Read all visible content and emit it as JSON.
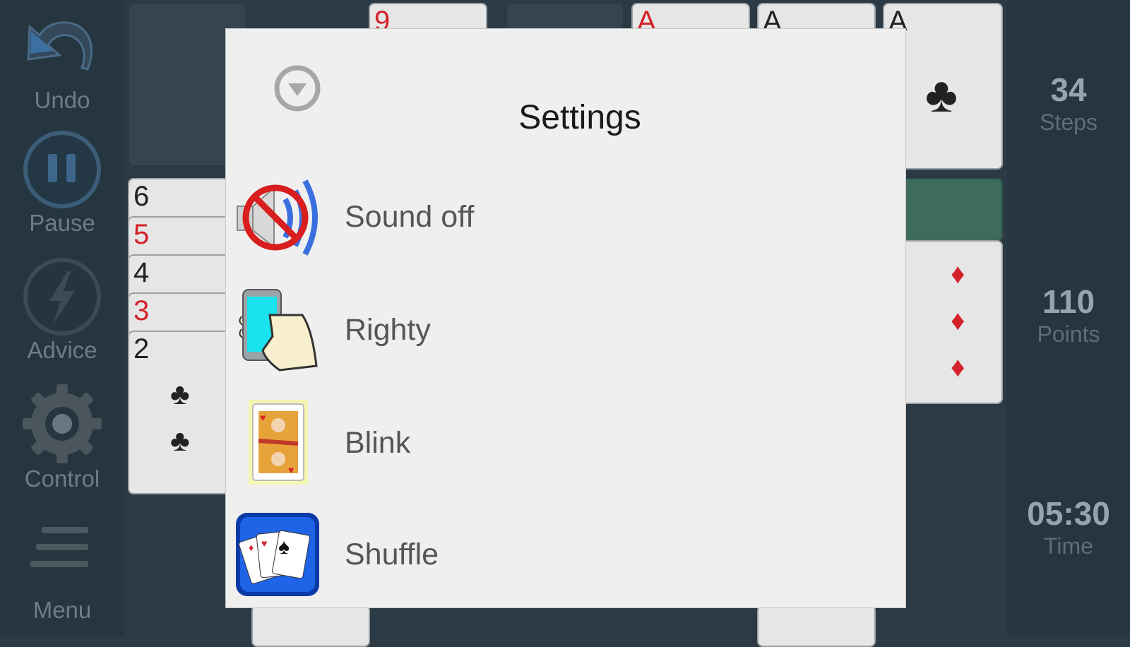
{
  "toolbar": {
    "undo": {
      "label": "Undo",
      "icon": "undo-arrow-icon"
    },
    "pause": {
      "label": "Pause",
      "icon": "pause-icon"
    },
    "advice": {
      "label": "Advice",
      "icon": "lightning-icon"
    },
    "control": {
      "label": "Control",
      "icon": "gear-icon"
    },
    "menu": {
      "label": "Menu",
      "icon": "hamburger-icon"
    }
  },
  "stats": {
    "steps": {
      "value": "34",
      "label": "Steps"
    },
    "points": {
      "value": "110",
      "label": "Points"
    },
    "time": {
      "value": "05:30",
      "label": "Time"
    }
  },
  "board": {
    "top_row": [
      "9",
      "A",
      "A",
      "A"
    ],
    "column_ranks": [
      "6",
      "5",
      "4",
      "3",
      "2"
    ]
  },
  "dialog": {
    "title": "Settings",
    "collapse_icon": "chevron-down-circle-icon",
    "options": [
      {
        "label": "Sound off",
        "icon": "sound-muted-icon"
      },
      {
        "label": "Righty",
        "icon": "hand-phone-icon"
      },
      {
        "label": "Blink",
        "icon": "queen-card-icon"
      },
      {
        "label": "Shuffle",
        "icon": "shuffle-cards-icon"
      }
    ]
  },
  "colors": {
    "background": "#2b3a44",
    "panel": "#263640",
    "dialog": "#efefef",
    "card_red": "#d4222b"
  }
}
